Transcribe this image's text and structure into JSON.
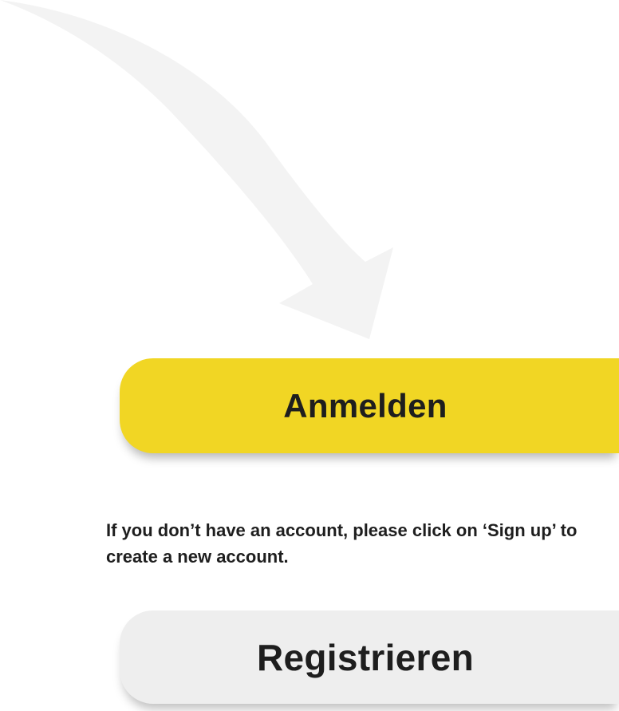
{
  "login_button": {
    "label": "Anmelden"
  },
  "info_text": "If you don’t have an account, please click on ‘Sign up’ to create a new account.",
  "register_button": {
    "label": "Registrieren"
  },
  "colors": {
    "primary_button": "#f1d624",
    "secondary_button": "#eeeeee",
    "arrow": "#f3f3f3",
    "text": "#1e1e1e"
  }
}
